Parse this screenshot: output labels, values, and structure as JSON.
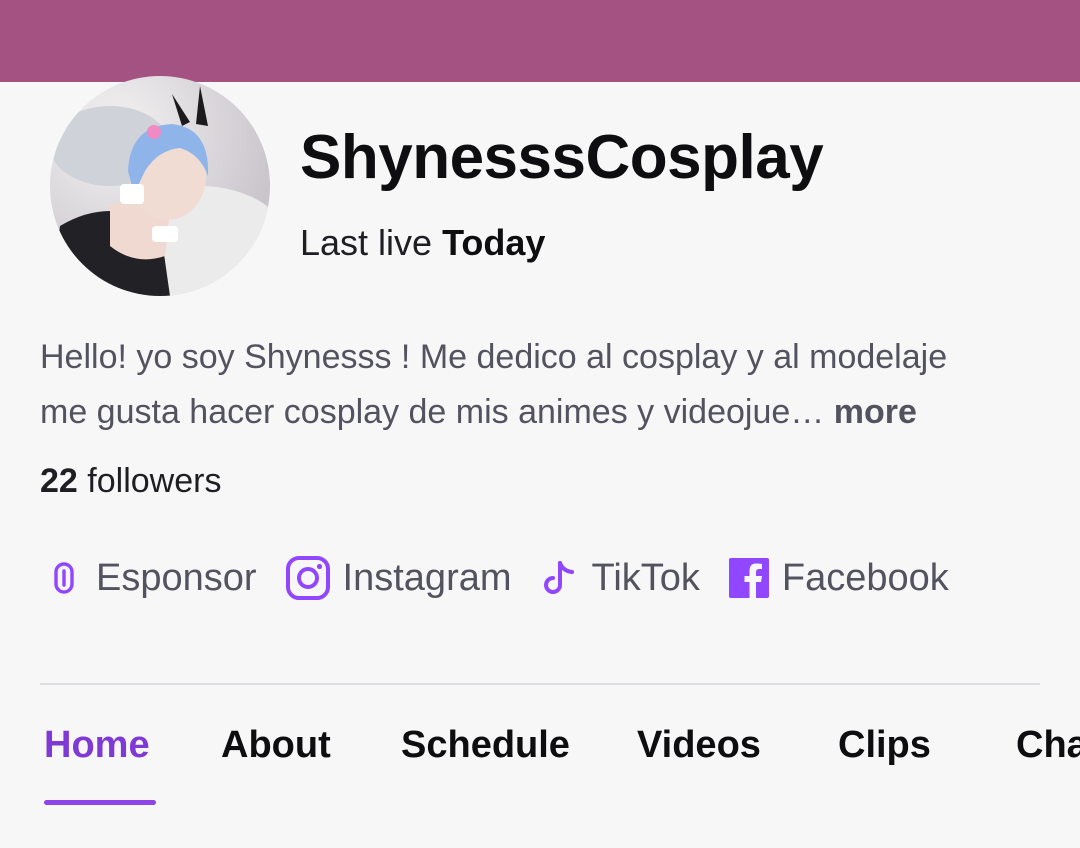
{
  "profile": {
    "channel_name": "ShynesssCosplay",
    "last_live_prefix": "Last live",
    "last_live_value": "Today",
    "bio_line1": "Hello! yo soy Shynesss ! Me dedico al cosplay y al modelaje",
    "bio_line2": "me gusta hacer cosplay de mis animes y videojue…",
    "bio_more": "more",
    "followers_count": "22",
    "followers_label": "followers"
  },
  "socials": [
    {
      "label": "Esponsor",
      "icon": "link-icon"
    },
    {
      "label": "Instagram",
      "icon": "instagram-icon"
    },
    {
      "label": "TikTok",
      "icon": "tiktok-icon"
    },
    {
      "label": "Facebook",
      "icon": "facebook-icon"
    }
  ],
  "tabs": [
    {
      "label": "Home",
      "active": true
    },
    {
      "label": "About",
      "active": false
    },
    {
      "label": "Schedule",
      "active": false
    },
    {
      "label": "Videos",
      "active": false
    },
    {
      "label": "Clips",
      "active": false
    },
    {
      "label": "Cha",
      "active": false
    }
  ],
  "colors": {
    "banner": "#a35281",
    "accent": "#8d45e6",
    "active_tab": "#7f3ad6",
    "muted_text": "#53535f",
    "background": "#f7f7f8"
  }
}
